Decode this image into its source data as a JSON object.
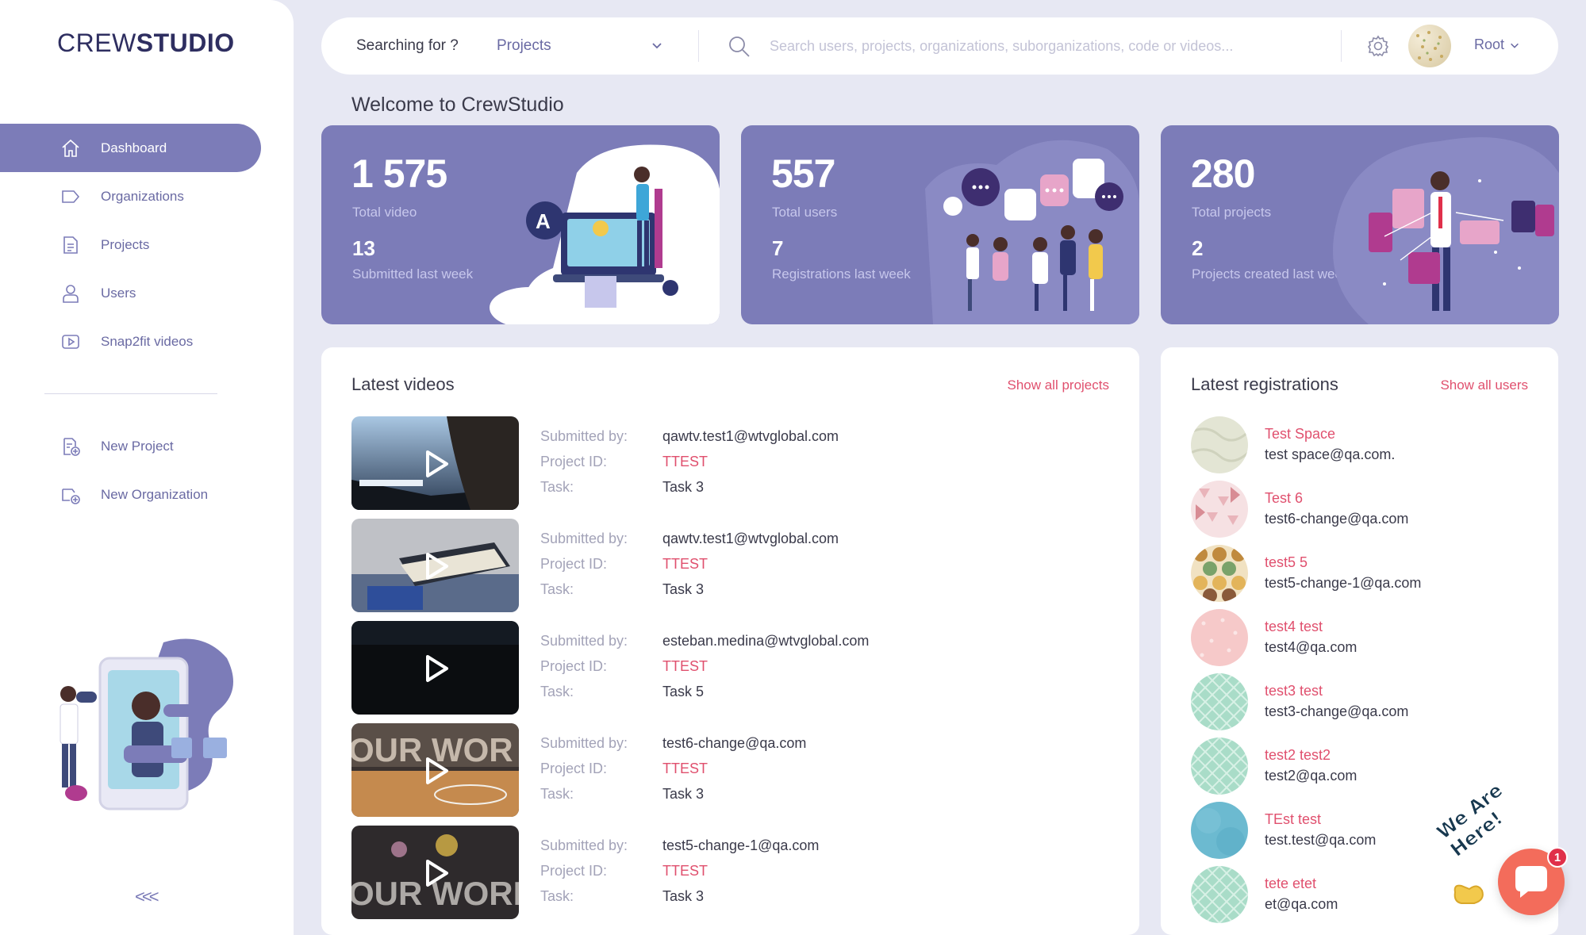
{
  "brand": {
    "part1": "CREW",
    "part2": "STUDIO"
  },
  "sidebar": {
    "items": [
      {
        "label": "Dashboard",
        "icon": "home-icon",
        "active": true
      },
      {
        "label": "Organizations",
        "icon": "tag-icon"
      },
      {
        "label": "Projects",
        "icon": "document-icon"
      },
      {
        "label": "Users",
        "icon": "user-icon"
      },
      {
        "label": "Snap2fit videos",
        "icon": "video-icon"
      }
    ],
    "actions": [
      {
        "label": "New Project",
        "icon": "new-project-icon"
      },
      {
        "label": "New Organization",
        "icon": "new-organization-icon"
      }
    ],
    "collapse_label": "<<<"
  },
  "topbar": {
    "search_label": "Searching for ?",
    "search_scope": "Projects",
    "search_placeholder": "Search users, projects, organizations, suborganizations, code or videos...",
    "user_name": "Root"
  },
  "welcome": "Welcome to CrewStudio",
  "stats": [
    {
      "value": "1 575",
      "label": "Total video",
      "sub_value": "13",
      "sub_label": "Submitted last week"
    },
    {
      "value": "557",
      "label": "Total users",
      "sub_value": "7",
      "sub_label": "Registrations last week"
    },
    {
      "value": "280",
      "label": "Total projects",
      "sub_value": "2",
      "sub_label": "Projects created last week"
    }
  ],
  "latest_videos": {
    "title": "Latest videos",
    "link": "Show all projects",
    "field_labels": {
      "submitted": "Submitted by:",
      "project": "Project ID:",
      "task": "Task:"
    },
    "rows": [
      {
        "submitted_by": "qawtv.test1@wtvglobal.com",
        "project_id": "TTEST",
        "task": "Task 3"
      },
      {
        "submitted_by": "qawtv.test1@wtvglobal.com",
        "project_id": "TTEST",
        "task": "Task 3"
      },
      {
        "submitted_by": "esteban.medina@wtvglobal.com",
        "project_id": "TTEST",
        "task": "Task 5"
      },
      {
        "submitted_by": "test6-change@qa.com",
        "project_id": "TTEST",
        "task": "Task 3"
      },
      {
        "submitted_by": "test5-change-1@qa.com",
        "project_id": "TTEST",
        "task": "Task 3"
      }
    ]
  },
  "latest_registrations": {
    "title": "Latest registrations",
    "link": "Show all users",
    "rows": [
      {
        "name": "Test Space",
        "email": "test space@qa.com."
      },
      {
        "name": "Test 6",
        "email": "test6-change@qa.com"
      },
      {
        "name": "test5 5",
        "email": "test5-change-1@qa.com"
      },
      {
        "name": "test4 test",
        "email": "test4@qa.com"
      },
      {
        "name": "test3 test",
        "email": "test3-change@qa.com"
      },
      {
        "name": "test2 test2",
        "email": "test2@qa.com"
      },
      {
        "name": "TEst test",
        "email": "test.test@qa.com"
      },
      {
        "name": "tete etet",
        "email": "et@qa.com"
      }
    ]
  },
  "chat": {
    "tagline": "We Are Here!",
    "badge": "1"
  },
  "colors": {
    "accent": "#7c7cb8",
    "link": "#e0506e",
    "background": "#e7e8f3",
    "chat": "#f36c5b"
  }
}
